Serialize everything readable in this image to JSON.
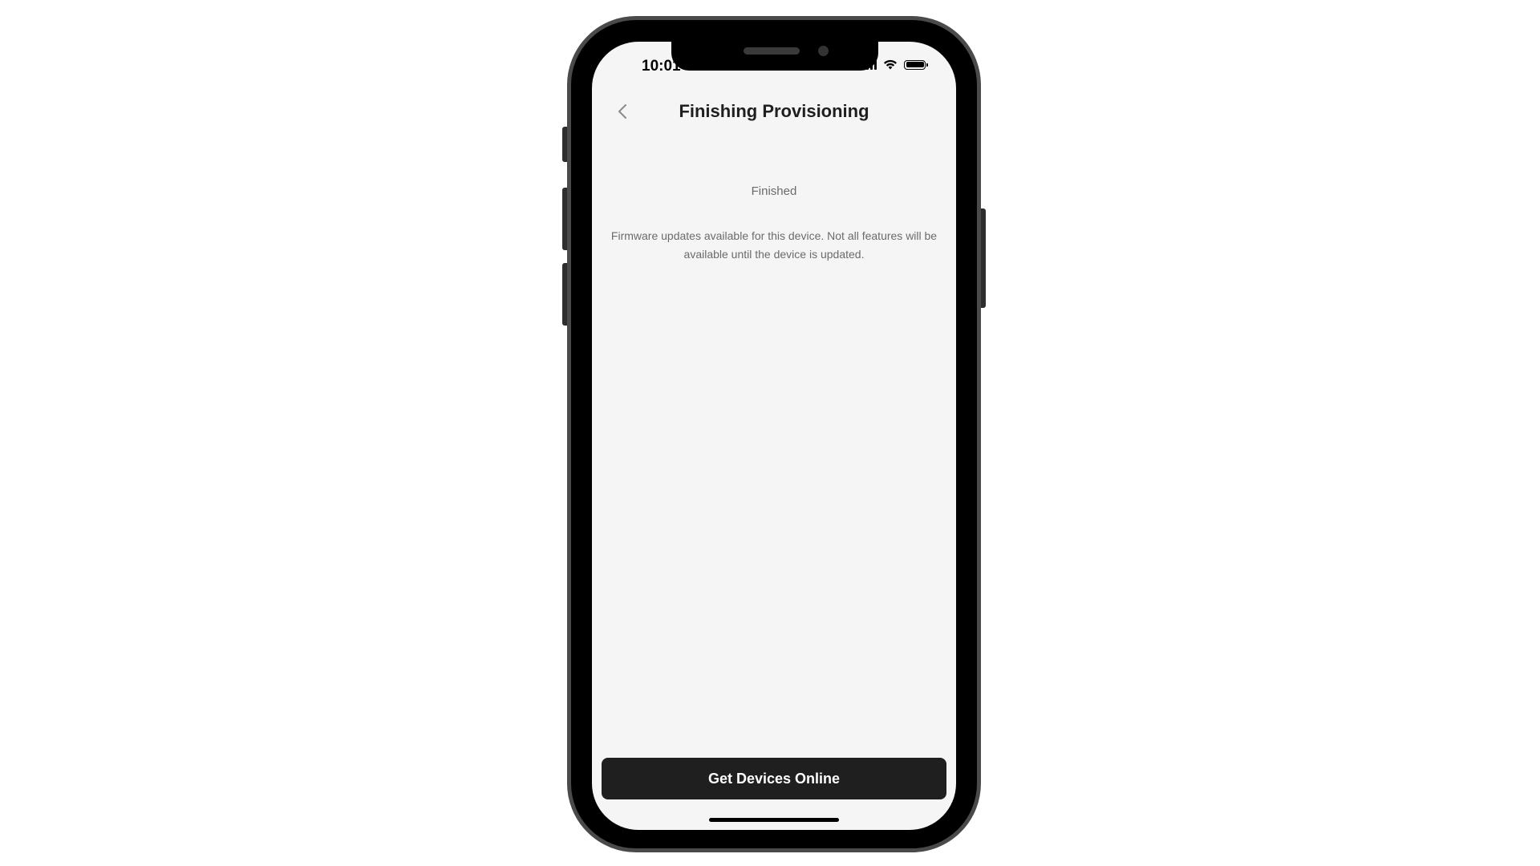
{
  "status_bar": {
    "time": "10:01",
    "icons": [
      "signal-icon",
      "wifi-icon",
      "battery-icon"
    ]
  },
  "header": {
    "title": "Finishing Provisioning",
    "back_icon": "chevron-left-icon"
  },
  "content": {
    "status": "Finished",
    "message": "Firmware updates available for this device. Not all features will be available until the device is updated."
  },
  "footer": {
    "primary_button": "Get Devices Online"
  },
  "colors": {
    "background": "#f5f5f5",
    "button": "#1f1f1f",
    "button_text": "#ffffff",
    "muted_text": "#6b6b6b"
  }
}
